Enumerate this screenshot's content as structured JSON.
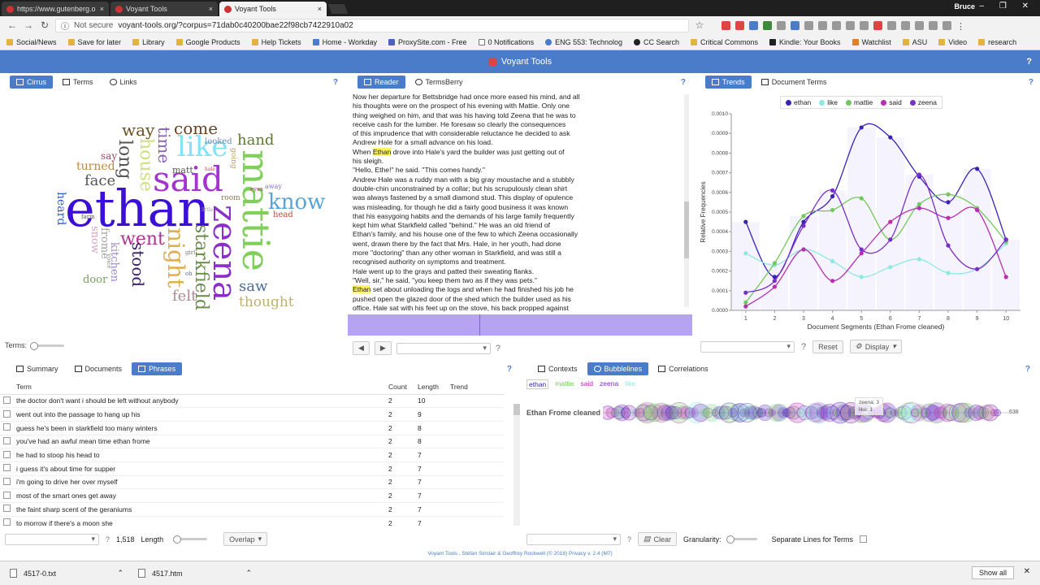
{
  "browser": {
    "tabs": [
      {
        "label": "https://www.gutenberg.o",
        "close": "×"
      },
      {
        "label": "Voyant Tools",
        "close": "×"
      },
      {
        "label": "Voyant Tools",
        "close": "×"
      }
    ],
    "user": "Bruce",
    "window_controls": "– ❐ ✕",
    "not_secure": "Not secure",
    "url": "voyant-tools.org/?corpus=71dab0c40200bae22f98cb7422910a02",
    "bookmarks": [
      "Social/News",
      "Save for later",
      "Library",
      "Google Products",
      "Help Tickets",
      "Home - Workday",
      "ProxySite.com - Free",
      "0 Notifications",
      "ENG 553: Technolog",
      "CC Search",
      "Critical Commons",
      "Kindle: Your Books",
      "Watchlist",
      "ASU",
      "Video",
      "research"
    ]
  },
  "app": {
    "title": "Voyant Tools",
    "help": "?"
  },
  "cirrus": {
    "tabs": [
      "Cirrus",
      "Terms",
      "Links"
    ],
    "words": [
      {
        "t": "ethan",
        "c": "#3b0fd6"
      },
      {
        "t": "said",
        "c": "#a334d0"
      },
      {
        "t": "mattie",
        "c": "#7fcf5a"
      },
      {
        "t": "zeena",
        "c": "#8b2fc9"
      },
      {
        "t": "like",
        "c": "#80e3f7"
      },
      {
        "t": "know",
        "c": "#5aa3d6"
      },
      {
        "t": "went",
        "c": "#b0348f"
      },
      {
        "t": "night",
        "c": "#e0b050"
      },
      {
        "t": "starkfield",
        "c": "#6a8b4a"
      },
      {
        "t": "long",
        "c": "#555"
      },
      {
        "t": "house",
        "c": "#cde07a"
      },
      {
        "t": "time",
        "c": "#8a5cc0"
      },
      {
        "t": "come",
        "c": "#6a4020"
      },
      {
        "t": "way",
        "c": "#6a5020"
      },
      {
        "t": "hand",
        "c": "#5a7a2a"
      },
      {
        "t": "face",
        "c": "#555"
      },
      {
        "t": "stood",
        "c": "#3a1a6a"
      },
      {
        "t": "saw",
        "c": "#4a6a9a"
      },
      {
        "t": "felt",
        "c": "#b08a90"
      },
      {
        "t": "thought",
        "c": "#c0b070"
      },
      {
        "t": "turned",
        "c": "#c08a40"
      },
      {
        "t": "heard",
        "c": "#2a5ad0"
      },
      {
        "t": "door",
        "c": "#7aa060"
      },
      {
        "t": "kitchen",
        "c": "#a08ad0"
      },
      {
        "t": "snow",
        "c": "#e0a0c0"
      },
      {
        "t": "frome",
        "c": "#a0a0a0"
      },
      {
        "t": "say",
        "c": "#a04a6a"
      },
      {
        "t": "matt",
        "c": "#555"
      },
      {
        "t": "head",
        "c": "#c04a30"
      },
      {
        "t": "looked",
        "c": "#6a8ab0"
      },
      {
        "t": "going",
        "c": "#c0a060"
      },
      {
        "t": "room",
        "c": "#8a7a60"
      },
      {
        "t": "away",
        "c": "#8a6ad0"
      },
      {
        "t": "eyes",
        "c": "#b04070"
      },
      {
        "t": "voice",
        "c": "#8a8a8a"
      },
      {
        "t": "farm",
        "c": "#555"
      },
      {
        "t": "girl",
        "c": "#777"
      },
      {
        "t": "oh",
        "c": "#6a6ab0"
      },
      {
        "t": "hale",
        "c": "#b05050"
      },
      {
        "t": "little",
        "c": "#999"
      }
    ],
    "terms_label": "Terms:"
  },
  "reader": {
    "tabs": [
      "Reader",
      "TermsBerry"
    ],
    "lines": [
      [
        "",
        "Now her departure for Bettsbridge had once more eased his mind, and all"
      ],
      [
        "",
        "his thoughts were on the prospect of his evening with Mattie. Only one"
      ],
      [
        "",
        "thing weighed on him, and that was his having told Zeena that he was to"
      ],
      [
        "",
        "receive cash for the lumber. He foresaw so clearly the consequences"
      ],
      [
        "",
        "of this imprudence that with considerable reluctance he decided to ask"
      ],
      [
        "",
        "Andrew Hale for a small advance on his load."
      ],
      [
        "When ",
        "Ethan",
        " drove into Hale's yard the builder was just getting out of"
      ],
      [
        "",
        "his sleigh."
      ],
      [
        "",
        "\"Hello, Ethe!\" he said. \"This comes handy.\""
      ],
      [
        "",
        "Andrew Hale was a ruddy man with a big gray moustache and a stubbly"
      ],
      [
        "",
        "double-chin unconstrained by a collar; but his scrupulously clean shirt"
      ],
      [
        "",
        "was always fastened by a small diamond stud. This display of opulence"
      ],
      [
        "",
        "was misleading, for though he did a fairly good business it was known"
      ],
      [
        "",
        "that his easygoing habits and the demands of his large family frequently"
      ],
      [
        "",
        "kept him what Starkfield called \"behind.\" He was an old friend of"
      ],
      [
        "",
        "Ethan's family, and his house one of the few to which Zeena occasionally"
      ],
      [
        "",
        "went, drawn there by the fact that Mrs. Hale, in her youth, had done"
      ],
      [
        "",
        "more \"doctoring\" than any other woman in Starkfield, and was still a"
      ],
      [
        "",
        "recognised authority on symptoms and treatment."
      ],
      [
        "",
        "Hale went up to the grays and patted their sweating flanks."
      ],
      [
        "",
        "\"Well, sir,\" he said, \"you keep them two as if they was pets.\""
      ],
      [
        "",
        "Ethan",
        " set about unloading the logs and when he had finished his job he"
      ],
      [
        "",
        "pushed open the glazed door of the shed which the builder used as his"
      ],
      [
        "",
        "office. Hale sat with his feet up on the stove, his back propped against"
      ]
    ]
  },
  "trends": {
    "tabs": [
      "Trends",
      "Document Terms"
    ],
    "buttons": {
      "reset": "Reset",
      "display": "Display"
    }
  },
  "chart_data": {
    "type": "line",
    "xlabel": "Document Segments (Ethan Frome cleaned)",
    "ylabel": "Relative Frequencies",
    "x": [
      1,
      2,
      3,
      4,
      5,
      6,
      7,
      8,
      9,
      10
    ],
    "ylim": [
      0,
      0.001
    ],
    "yticks": [
      "0.0000",
      "0.0001",
      "0.0002",
      "0.0003",
      "0.0004",
      "0.0005",
      "0.0006",
      "0.0007",
      "0.0008",
      "0.0009",
      "0.0010"
    ],
    "series": [
      {
        "name": "ethan",
        "color": "#3b22b5",
        "values": [
          0.00045,
          0.00017,
          0.00045,
          0.00058,
          0.00093,
          0.00088,
          0.00068,
          0.00055,
          0.00072,
          0.00036
        ]
      },
      {
        "name": "like",
        "color": "#8ee8e2",
        "values": [
          0.00029,
          0.00023,
          0.00031,
          0.00025,
          0.00017,
          0.00022,
          0.00026,
          0.00019,
          0.00021,
          0.00034
        ]
      },
      {
        "name": "mattie",
        "color": "#72c85a",
        "values": [
          4e-05,
          0.00024,
          0.00048,
          0.00051,
          0.00057,
          0.00036,
          0.00054,
          0.00059,
          0.00052,
          0.00035
        ]
      },
      {
        "name": "said",
        "color": "#b72eb0",
        "values": [
          2e-05,
          0.00012,
          0.00031,
          0.00015,
          0.00029,
          0.00045,
          0.00052,
          0.00047,
          0.00051,
          0.00017
        ]
      },
      {
        "name": "zeena",
        "color": "#7a2ec8",
        "values": [
          9e-05,
          0.00015,
          0.00043,
          0.00061,
          0.00031,
          0.00036,
          0.00069,
          0.00033,
          0.00021,
          0.00036
        ]
      }
    ]
  },
  "phrases": {
    "tabs": [
      "Summary",
      "Documents",
      "Phrases"
    ],
    "columns": [
      "Term",
      "Count",
      "Length",
      "Trend"
    ],
    "rows": [
      [
        "the doctor don't want i should be left without anybody",
        "2",
        "10"
      ],
      [
        "went out into the passage to hang up his",
        "2",
        "9"
      ],
      [
        "guess he's been in starkfield too many winters",
        "2",
        "8"
      ],
      [
        "you've had an awful mean time ethan frome",
        "2",
        "8"
      ],
      [
        "he had to stoop his head to",
        "2",
        "7"
      ],
      [
        "i guess it's about time for supper",
        "2",
        "7"
      ],
      [
        "i'm going to drive her over myself",
        "2",
        "7"
      ],
      [
        "most of the smart ones get away",
        "2",
        "7"
      ],
      [
        "the faint sharp scent of the geraniums",
        "2",
        "7"
      ],
      [
        "to morrow if there's a moon she",
        "2",
        "7"
      ]
    ],
    "footer": {
      "count": "1,518",
      "length": "Length",
      "overlap": "Overlap"
    }
  },
  "bubblelines": {
    "tabs": [
      "Contexts",
      "Bubblelines",
      "Correlations"
    ],
    "terms": [
      {
        "t": "ethan",
        "c": "#3b22b5"
      },
      {
        "t": "mattie",
        "c": "#72c85a"
      },
      {
        "t": "said",
        "c": "#b72eb0"
      },
      {
        "t": "zeena",
        "c": "#7a2ec8"
      },
      {
        "t": "like",
        "c": "#8ee8e2"
      }
    ],
    "doc_label": "Ethan Frome cleaned",
    "total": "638",
    "tooltip": [
      "zeena: 3",
      "like: 1"
    ],
    "footer": {
      "clear": "Clear",
      "granularity": "Granularity:",
      "separate": "Separate Lines for Terms"
    }
  },
  "status": "Voyant Tools , Stéfan Sinclair & Geoffrey Rockwell (© 2018) Privacy v. 2.4 (M7)",
  "downloads": {
    "items": [
      "4517-0.txt",
      "4517.htm"
    ],
    "show_all": "Show all",
    "close": "✕"
  }
}
